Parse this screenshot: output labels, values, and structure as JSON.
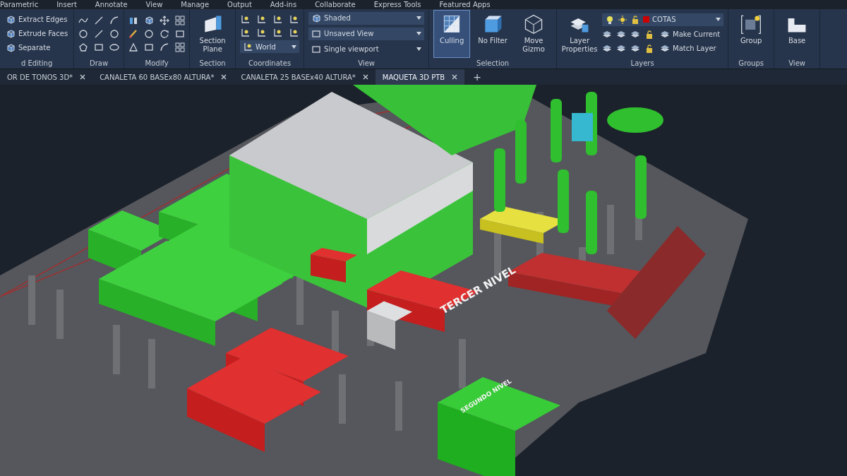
{
  "menu_tabs": [
    {
      "label": "Parametric"
    },
    {
      "label": "Insert"
    },
    {
      "label": "Annotate"
    },
    {
      "label": "View"
    },
    {
      "label": "Manage"
    },
    {
      "label": "Output"
    },
    {
      "label": "Add-ins"
    },
    {
      "label": "Collaborate"
    },
    {
      "label": "Express Tools"
    },
    {
      "label": "Featured Apps"
    }
  ],
  "ribbon_panels": [
    {
      "kind": "commands",
      "title": "d Editing",
      "items": [
        {
          "label": "Extract Edges"
        },
        {
          "label": "Extrude Faces"
        },
        {
          "label": "Separate"
        }
      ]
    },
    {
      "kind": "icons",
      "title": "Draw"
    },
    {
      "kind": "icons",
      "title": "Modify"
    },
    {
      "kind": "large",
      "title": "Section",
      "items": [
        {
          "label": "Section Plane",
          "selected": false
        }
      ]
    },
    {
      "kind": "coords",
      "title": "Coordinates",
      "dropdown": "World"
    },
    {
      "kind": "dropdowns",
      "title": "View",
      "items": [
        {
          "label": "Shaded"
        },
        {
          "label": "Unsaved View"
        },
        {
          "label": "Single viewport"
        }
      ]
    },
    {
      "kind": "large",
      "title": "Selection",
      "items": [
        {
          "label": "Culling",
          "selected": true
        },
        {
          "label": "No Filter",
          "selected": false
        },
        {
          "label": "Move Gizmo",
          "selected": false
        }
      ]
    },
    {
      "kind": "layers",
      "title": "Layers",
      "large": "Layer Properties",
      "layer": {
        "name": "COTAS",
        "color": "#cc0000"
      },
      "commands": [
        {
          "label": "Make Current"
        },
        {
          "label": "Match Layer"
        }
      ]
    },
    {
      "kind": "large",
      "title": "Groups",
      "items": [
        {
          "label": "Group",
          "selected": false
        }
      ]
    },
    {
      "kind": "large",
      "title": "View",
      "items": [
        {
          "label": "Base",
          "selected": false
        }
      ]
    }
  ],
  "document_tabs": [
    {
      "label": "OR DE TONOS 3D*",
      "selected": false
    },
    {
      "label": "CANALETA 60 BASEx80 ALTURA*",
      "selected": false
    },
    {
      "label": "CANALETA 25 BASEx40 ALTURA*",
      "selected": false
    },
    {
      "label": "MAQUETA 3D PTB",
      "selected": true
    }
  ],
  "new_tab": "+",
  "viewport": {
    "labels": [
      "TERCER NIVEL",
      "SEGUNDO NIVEL"
    ]
  }
}
